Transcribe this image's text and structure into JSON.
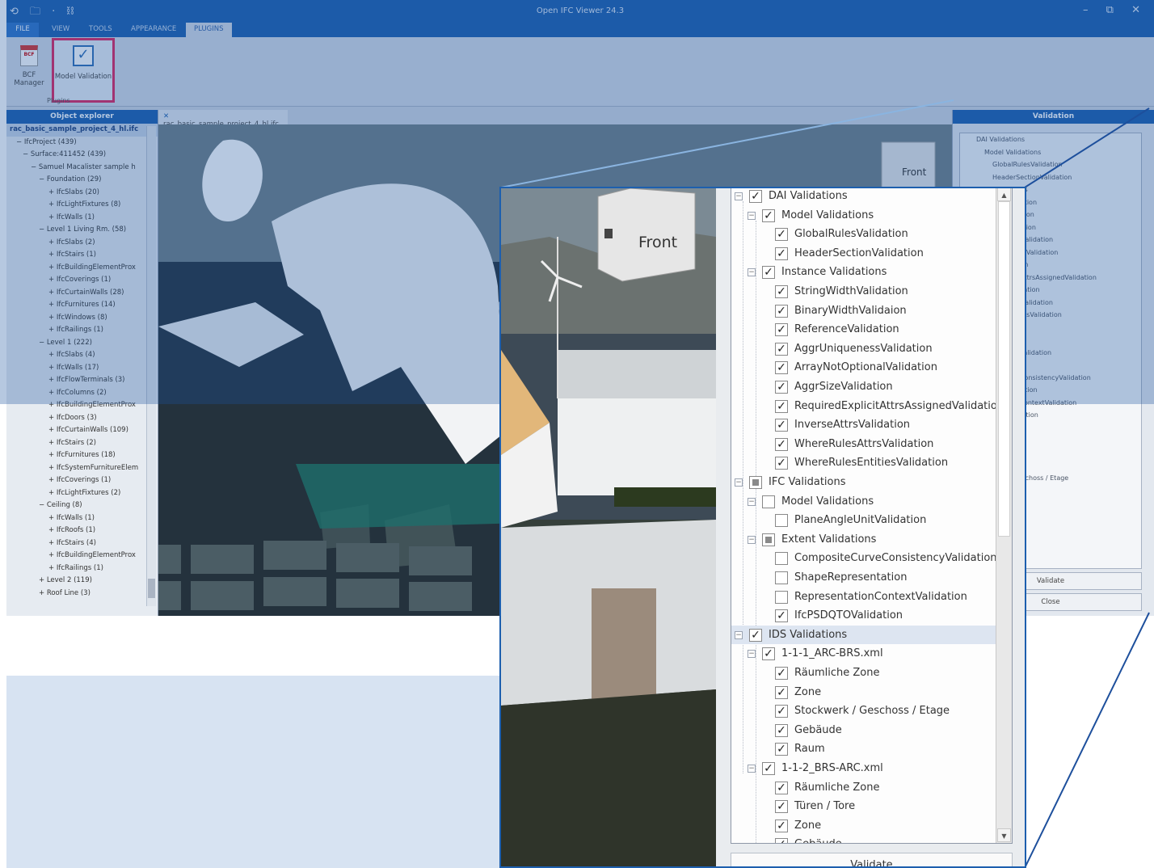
{
  "app": {
    "title": "Open IFC Viewer 24.3",
    "quick_access": "⟲ 🗀 · ⛓",
    "window_controls": "– ⧉ ✕",
    "tabs": [
      "FILE",
      "VIEW",
      "TOOLS",
      "APPEARANCE",
      "PLUGINS"
    ],
    "ribbon": {
      "bcf_icon": "BCF",
      "bcf_label": "BCF Manager",
      "model_validation_label": "Model Validation",
      "group_label": "Plugins"
    },
    "explorer": {
      "title": "Object explorer",
      "items": [
        "rac_basic_sample_project_4_hl.ifc",
        "− IfcProject (439)",
        "− Surface:411452 (439)",
        "− Samuel Macalister sample h",
        "− Foundation (29)",
        "+ IfcSlabs (20)",
        "+ IfcLightFixtures (8)",
        "+ IfcWalls (1)",
        "− Level 1 Living Rm. (58)",
        "+ IfcSlabs (2)",
        "+ IfcStairs (1)",
        "+ IfcBuildingElementProx",
        "+ IfcCoverings (1)",
        "+ IfcCurtainWalls (28)",
        "+ IfcFurnitures (14)",
        "+ IfcWindows (8)",
        "+ IfcRailings (1)",
        "− Level 1 (222)",
        "+ IfcSlabs (4)",
        "+ IfcWalls (17)",
        "+ IfcFlowTerminals (3)",
        "+ IfcColumns (2)",
        "+ IfcBuildingElementProx",
        "+ IfcDoors (3)",
        "+ IfcCurtainWalls (109)",
        "+ IfcStairs (2)",
        "+ IfcFurnitures (18)",
        "+ IfcSystemFurnitureElem",
        "+ IfcCoverings (1)",
        "+ IfcLightFixtures (2)",
        "− Ceiling (8)",
        "+ IfcWalls (1)",
        "+ IfcRoofs (1)",
        "+ IfcStairs (4)",
        "+ IfcBuildingElementProx",
        "+ IfcRailings (1)",
        "+ Level 2 (119)",
        "+ Roof Line (3)"
      ]
    },
    "view_tab": "rac_basic_sample_project_4_hl.ifc",
    "nav_cube_label": "Front",
    "validation_panel": {
      "title": "Validation",
      "validate_label": "Validate",
      "close_label": "Close",
      "items": [
        "DAI Validations",
        "Model Validations",
        "GlobalRulesValidation",
        "HeaderSectionValidation",
        "Validations",
        "idthValidation",
        "idthValidaion",
        "nceValidation",
        "iquenessValidation",
        "otOptionalValidation",
        "eValidation",
        "dExplicitAttrsAssignedValidation",
        "AttrsValidation",
        "ulesAttrsValidation",
        "ulesEntitiesValidation",
        "s",
        "dations",
        "ngleUnitValidation",
        "lidations",
        "iteCurveConsistencyValidation",
        "epresentation",
        "entationContextValidation",
        "QTOValidation",
        "ns",
        "-BRS.xml",
        "he Zone",
        "",
        "verk / Geschoss / Etage",
        "",
        "",
        "S-ARC.xml",
        "he Zone",
        "/ Tore"
      ]
    }
  },
  "inset": {
    "nav_cube_label": "Front",
    "validate_label": "Validate",
    "tree": [
      {
        "label": "DAI Validations",
        "level": 0,
        "check": "checked",
        "expander": "−"
      },
      {
        "label": "Model Validations",
        "level": 1,
        "check": "checked",
        "expander": "−"
      },
      {
        "label": "GlobalRulesValidation",
        "level": 2,
        "check": "checked"
      },
      {
        "label": "HeaderSectionValidation",
        "level": 2,
        "check": "checked"
      },
      {
        "label": "Instance Validations",
        "level": 1,
        "check": "checked",
        "expander": "−"
      },
      {
        "label": "StringWidthValidation",
        "level": 2,
        "check": "checked"
      },
      {
        "label": "BinaryWidthValidaion",
        "level": 2,
        "check": "checked"
      },
      {
        "label": "ReferenceValidation",
        "level": 2,
        "check": "checked"
      },
      {
        "label": "AggrUniquenessValidation",
        "level": 2,
        "check": "checked"
      },
      {
        "label": "ArrayNotOptionalValidation",
        "level": 2,
        "check": "checked"
      },
      {
        "label": "AggrSizeValidation",
        "level": 2,
        "check": "checked"
      },
      {
        "label": "RequiredExplicitAttrsAssignedValidation",
        "level": 2,
        "check": "checked"
      },
      {
        "label": "InverseAttrsValidation",
        "level": 2,
        "check": "checked"
      },
      {
        "label": "WhereRulesAttrsValidation",
        "level": 2,
        "check": "checked"
      },
      {
        "label": "WhereRulesEntitiesValidation",
        "level": 2,
        "check": "checked"
      },
      {
        "label": "IFC Validations",
        "level": 0,
        "check": "partial",
        "expander": "−"
      },
      {
        "label": "Model Validations",
        "level": 1,
        "check": "unchecked",
        "expander": "−"
      },
      {
        "label": "PlaneAngleUnitValidation",
        "level": 2,
        "check": "unchecked"
      },
      {
        "label": "Extent Validations",
        "level": 1,
        "check": "partial",
        "expander": "−"
      },
      {
        "label": "CompositeCurveConsistencyValidation",
        "level": 2,
        "check": "unchecked"
      },
      {
        "label": "ShapeRepresentation",
        "level": 2,
        "check": "unchecked"
      },
      {
        "label": "RepresentationContextValidation",
        "level": 2,
        "check": "unchecked"
      },
      {
        "label": "IfcPSDQTOValidation",
        "level": 2,
        "check": "checked"
      },
      {
        "label": "IDS Validations",
        "level": 0,
        "check": "checked",
        "expander": "−",
        "selected": true
      },
      {
        "label": "1-1-1_ARC-BRS.xml",
        "level": 1,
        "check": "checked",
        "expander": "−"
      },
      {
        "label": "Räumliche Zone",
        "level": 2,
        "check": "checked"
      },
      {
        "label": "Zone",
        "level": 2,
        "check": "checked"
      },
      {
        "label": "Stockwerk / Geschoss / Etage",
        "level": 2,
        "check": "checked"
      },
      {
        "label": "Gebäude",
        "level": 2,
        "check": "checked"
      },
      {
        "label": "Raum",
        "level": 2,
        "check": "checked"
      },
      {
        "label": "1-1-2_BRS-ARC.xml",
        "level": 1,
        "check": "checked",
        "expander": "−"
      },
      {
        "label": "Räumliche Zone",
        "level": 2,
        "check": "checked"
      },
      {
        "label": "Türen / Tore",
        "level": 2,
        "check": "checked"
      },
      {
        "label": "Zone",
        "level": 2,
        "check": "checked"
      },
      {
        "label": "Gebäude",
        "level": 2,
        "check": "checked"
      }
    ]
  },
  "colors": {
    "brand_blue": "#1d5fae",
    "highlight_border": "#e0245e",
    "callout_fill": "#d7e3f2",
    "selected_row": "#dde5f1"
  }
}
